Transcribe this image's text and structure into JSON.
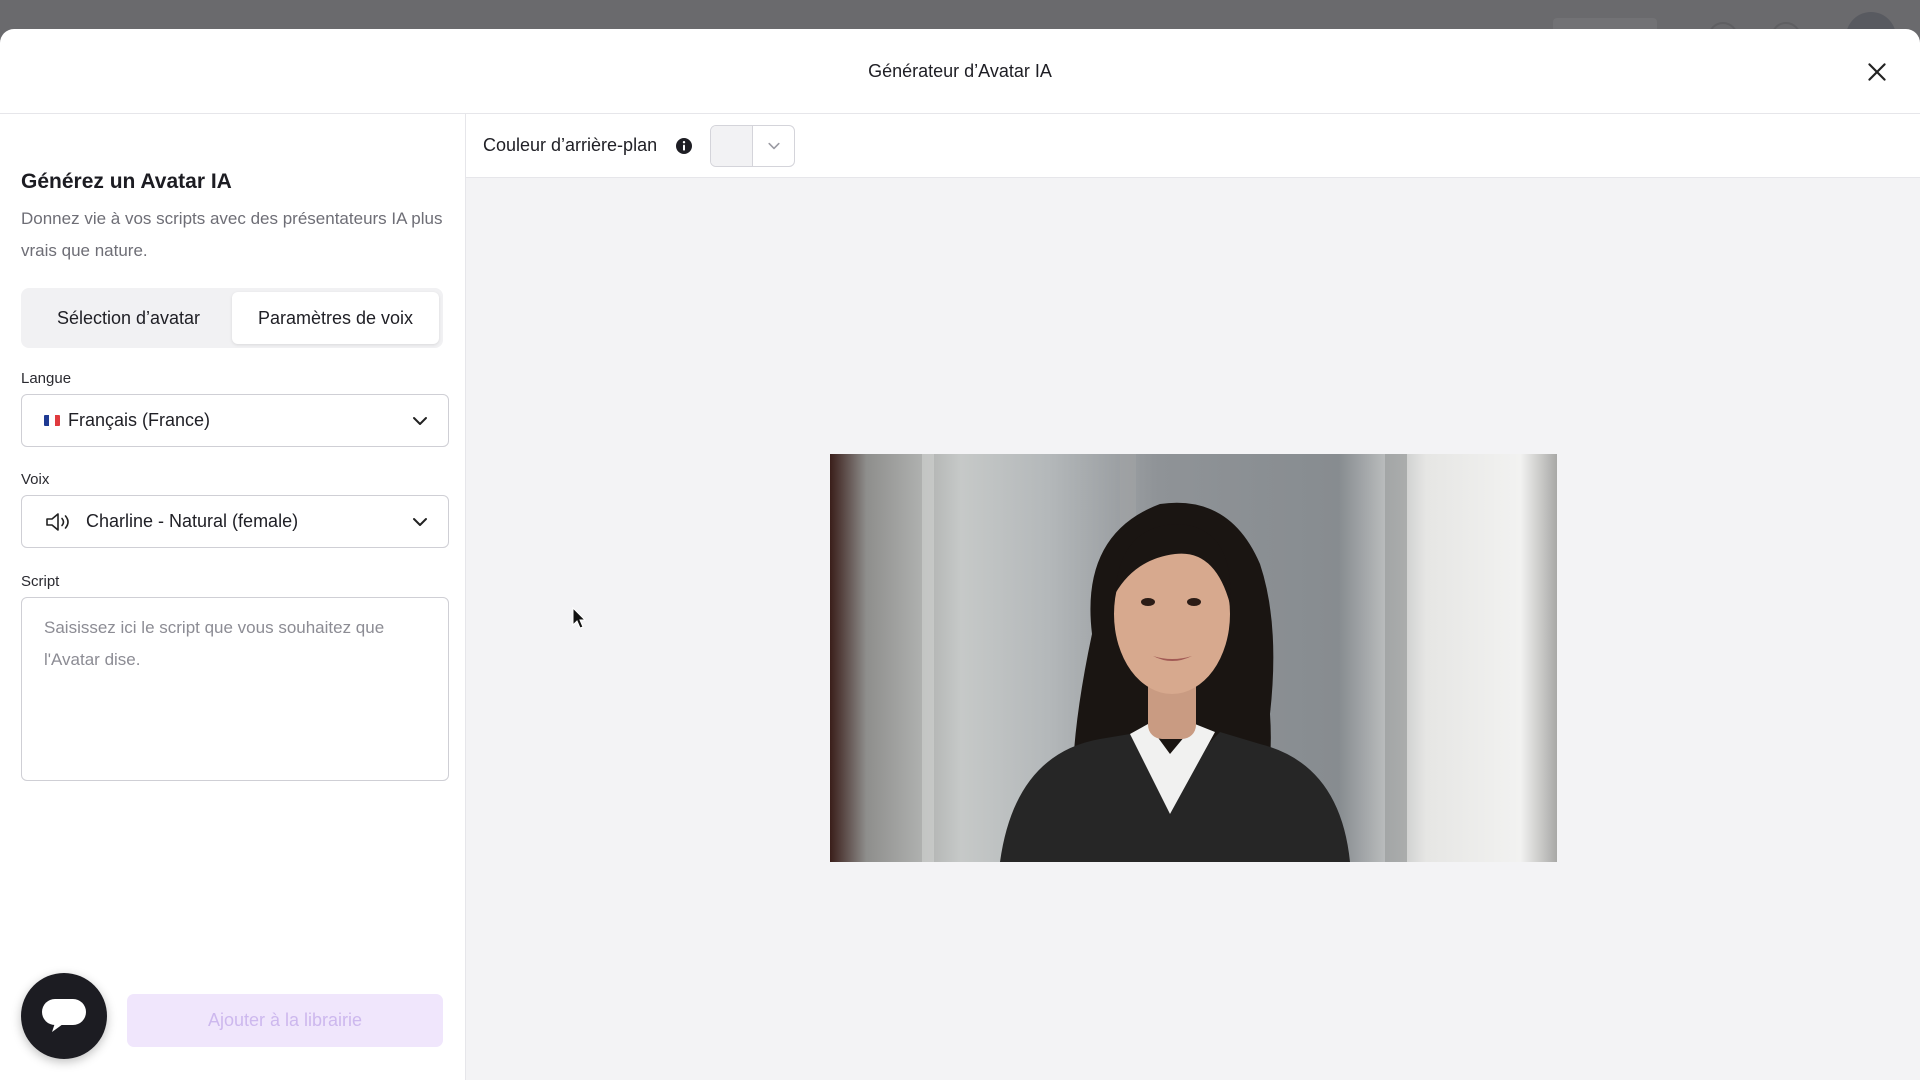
{
  "modal": {
    "title": "Générateur d’Avatar IA"
  },
  "sidebar": {
    "title": "Générez un Avatar IA",
    "subtitle": "Donnez vie à vos scripts avec des présentateurs IA plus vrais que nature.",
    "tabs": [
      {
        "label": "Sélection d’avatar",
        "active": false
      },
      {
        "label": "Paramètres de voix",
        "active": true
      }
    ],
    "language": {
      "label": "Langue",
      "value": "Français (France)",
      "flag_colors": [
        "#1f3a93",
        "#ffffff",
        "#e03a3e"
      ]
    },
    "voice": {
      "label": "Voix",
      "value": "Charline - Natural (female)"
    },
    "script": {
      "label": "Script",
      "value": "",
      "placeholder": "Saisissez ici le script que vous souhaitez que l'Avatar dise."
    },
    "add_button_label": "Ajouter à la librairie"
  },
  "toolbar": {
    "background_color_label": "Couleur d’arrière-plan"
  },
  "icons": {
    "close": "close-icon",
    "info": "info-icon",
    "speaker": "speaker-icon",
    "chat": "chat-bubble-icon",
    "chevron": "chevron-down-icon"
  },
  "colors": {
    "accent_disabled_bg": "#f0e6fc",
    "accent_disabled_text": "#cdb8ee",
    "fab_bg": "#1c1c22"
  }
}
